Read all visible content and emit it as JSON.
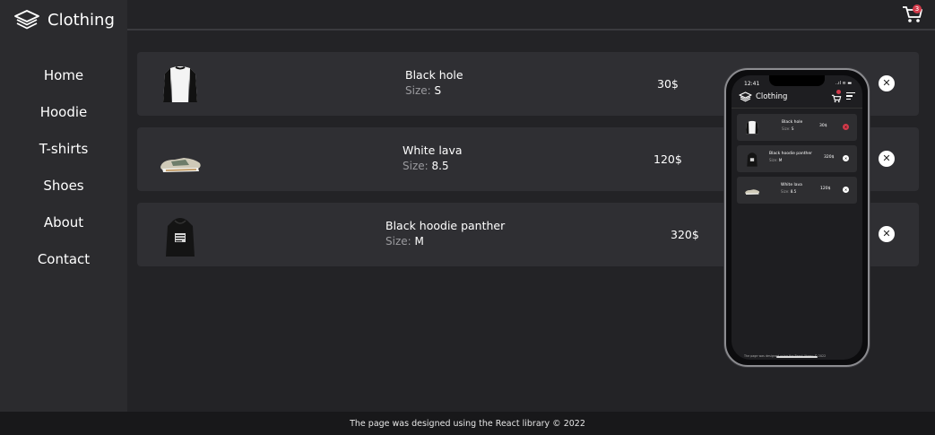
{
  "brand": {
    "name": "Clothing"
  },
  "nav": {
    "items": [
      {
        "label": "Home"
      },
      {
        "label": "Hoodie"
      },
      {
        "label": "T-shirts"
      },
      {
        "label": "Shoes"
      },
      {
        "label": "About"
      },
      {
        "label": "Contact"
      }
    ]
  },
  "cart": {
    "count": "3"
  },
  "items": [
    {
      "name": "Black hole",
      "size_label": "Size: ",
      "size": "S",
      "price": "30$",
      "remove": "✕"
    },
    {
      "name": "White lava",
      "size_label": "Size: ",
      "size": "8.5",
      "price": "120$",
      "remove": "✕"
    },
    {
      "name": "Black hoodie panther",
      "size_label": "Size: ",
      "size": "M",
      "price": "320$",
      "remove": "✕"
    }
  ],
  "footer": {
    "text": "The page was designed using the React library © 2022"
  },
  "phone": {
    "time": "12:41",
    "status": "..ıl ≋ ▬",
    "brand": "Clothing",
    "items": [
      {
        "name": "Black hole",
        "size_label": "Size: ",
        "size": "S",
        "price": "30$",
        "remove": "✕"
      },
      {
        "name": "Black hoodie panther",
        "size_label": "Size: ",
        "size": "M",
        "price": "320$",
        "remove": "✕"
      },
      {
        "name": "White lava",
        "size_label": "Size: ",
        "size": "8.5",
        "price": "120$",
        "remove": "✕"
      }
    ],
    "footer": "The page was designed using the React library © 2022"
  },
  "colors": {
    "background": "#232326",
    "sidebar": "#2b2b2e",
    "row": "#2f2f33",
    "footer": "#18181a",
    "badge": "#d23a4a"
  }
}
